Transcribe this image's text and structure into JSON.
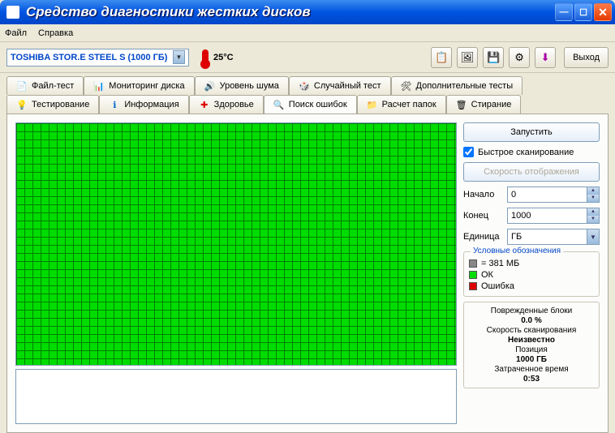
{
  "window": {
    "title": "Средство диагностики жестких дисков"
  },
  "menu": {
    "file": "Файл",
    "help": "Справка"
  },
  "toolbar": {
    "drive": "TOSHIBA STOR.E STEEL S  (1000 ГБ)",
    "temp": "25°C",
    "exit": "Выход"
  },
  "tabs_top": [
    {
      "label": "Файл-тест"
    },
    {
      "label": "Мониторинг диска"
    },
    {
      "label": "Уровень шума"
    },
    {
      "label": "Случайный тест"
    },
    {
      "label": "Дополнительные тесты"
    }
  ],
  "tabs_bottom": [
    {
      "label": "Тестирование"
    },
    {
      "label": "Информация"
    },
    {
      "label": "Здоровье"
    },
    {
      "label": "Поиск ошибок"
    },
    {
      "label": "Расчет папок"
    },
    {
      "label": "Стирание"
    }
  ],
  "panel": {
    "run": "Запустить",
    "quick": "Быстрое сканирование",
    "display_speed": "Скорость отображения",
    "start_label": "Начало",
    "start_value": "0",
    "end_label": "Конец",
    "end_value": "1000",
    "unit_label": "Единица",
    "unit_value": "ГБ"
  },
  "legend": {
    "title": "Условные обозначения",
    "cell": "= 381 МБ",
    "ok": "ОК",
    "error": "Ошибка"
  },
  "stats": {
    "damaged_label": "Поврежденные блоки",
    "damaged_value": "0.0 %",
    "speed_label": "Скорость сканирования",
    "speed_value": "Неизвестно",
    "pos_label": "Позиция",
    "pos_value": "1000 ГБ",
    "time_label": "Затраченное время",
    "time_value": "0:53"
  }
}
